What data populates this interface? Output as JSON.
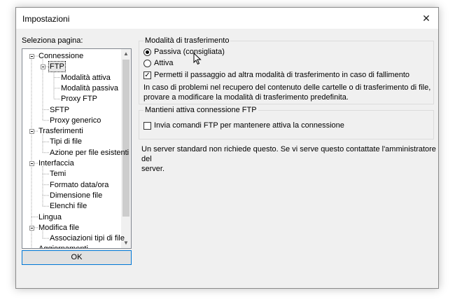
{
  "window": {
    "title": "Impostazioni"
  },
  "sidebar": {
    "label": "Seleziona pagina:",
    "tree": [
      {
        "label": "Connessione",
        "level": 0,
        "expander": true
      },
      {
        "label": "FTP",
        "level": 1,
        "expander": true,
        "selected": true
      },
      {
        "label": "Modalità attiva",
        "level": 2
      },
      {
        "label": "Modalità passiva",
        "level": 2
      },
      {
        "label": "Proxy FTP",
        "level": 2
      },
      {
        "label": "SFTP",
        "level": 1
      },
      {
        "label": "Proxy generico",
        "level": 1
      },
      {
        "label": "Trasferimenti",
        "level": 0,
        "expander": true
      },
      {
        "label": "Tipi di file",
        "level": 1
      },
      {
        "label": "Azione per file esistenti",
        "level": 1
      },
      {
        "label": "Interfaccia",
        "level": 0,
        "expander": true
      },
      {
        "label": "Temi",
        "level": 1
      },
      {
        "label": "Formato data/ora",
        "level": 1
      },
      {
        "label": "Dimensione file",
        "level": 1
      },
      {
        "label": "Elenchi file",
        "level": 1
      },
      {
        "label": "Lingua",
        "level": 0
      },
      {
        "label": "Modifica file",
        "level": 0,
        "expander": true
      },
      {
        "label": "Associazioni tipi di file",
        "level": 1
      },
      {
        "label": "Aggiornamenti",
        "level": 0
      }
    ],
    "ok_label": "OK"
  },
  "transfer_mode": {
    "title": "Modalità di trasferimento",
    "options": [
      "Passiva (consigliata)",
      "Attiva"
    ],
    "selected_index": 0,
    "fallback_label": "Permetti il passaggio ad altra modalità di trasferimento in caso di fallimento",
    "fallback_checked": true,
    "help_line1": "In caso di problemi nel recupero del contenuto delle cartelle o di trasferimento di file,",
    "help_line2": "provare a modificare la modalità di trasferimento predefinita."
  },
  "keepalive": {
    "title": "Mantieni attiva connessione FTP",
    "checkbox_label": "Invia comandi FTP per mantenere attiva la connessione",
    "checked": false,
    "note_line1": "Un server standard non richiede questo. Se vi serve questo contattate l'amministratore del",
    "note_line2": "server."
  },
  "icons": {
    "close": "close-icon",
    "cursor": "mouse-cursor-icon"
  }
}
